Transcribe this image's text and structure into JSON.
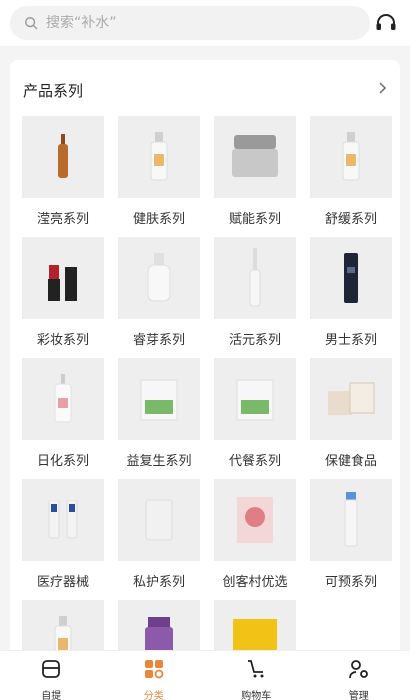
{
  "search": {
    "placeholder": "搜索“补水”"
  },
  "section": {
    "title": "产品系列"
  },
  "products": [
    {
      "label": "滢亮系列",
      "icon": "ampoule-icon"
    },
    {
      "label": "健肤系列",
      "icon": "bottle-icon"
    },
    {
      "label": "赋能系列",
      "icon": "cream-jar-icon"
    },
    {
      "label": "舒缓系列",
      "icon": "bottle-icon"
    },
    {
      "label": "彩妆系列",
      "icon": "lipstick-icon"
    },
    {
      "label": "睿芽系列",
      "icon": "spray-bottle-icon"
    },
    {
      "label": "活元系列",
      "icon": "dropper-icon"
    },
    {
      "label": "男士系列",
      "icon": "dark-bottle-icon"
    },
    {
      "label": "日化系列",
      "icon": "pump-bottle-icon"
    },
    {
      "label": "益复生系列",
      "icon": "box-icon"
    },
    {
      "label": "代餐系列",
      "icon": "box-icon"
    },
    {
      "label": "保健食品",
      "icon": "boxes-icon"
    },
    {
      "label": "医疗器械",
      "icon": "vials-icon"
    },
    {
      "label": "私护系列",
      "icon": "pouch-icon"
    },
    {
      "label": "创客村优选",
      "icon": "mask-pack-icon"
    },
    {
      "label": "可预系列",
      "icon": "tube-icon"
    },
    {
      "label": "",
      "icon": "bottle-icon"
    },
    {
      "label": "",
      "icon": "supplement-jar-icon"
    },
    {
      "label": "",
      "icon": "yellow-cloth-icon"
    }
  ],
  "tabs": [
    {
      "label": "自提",
      "icon": "store-icon"
    },
    {
      "label": "分类",
      "icon": "category-icon",
      "active": true
    },
    {
      "label": "购物车",
      "icon": "cart-icon"
    },
    {
      "label": "管理",
      "icon": "manage-icon"
    }
  ],
  "colors": {
    "accent": "#e8863a",
    "background": "#f4f4f4"
  }
}
